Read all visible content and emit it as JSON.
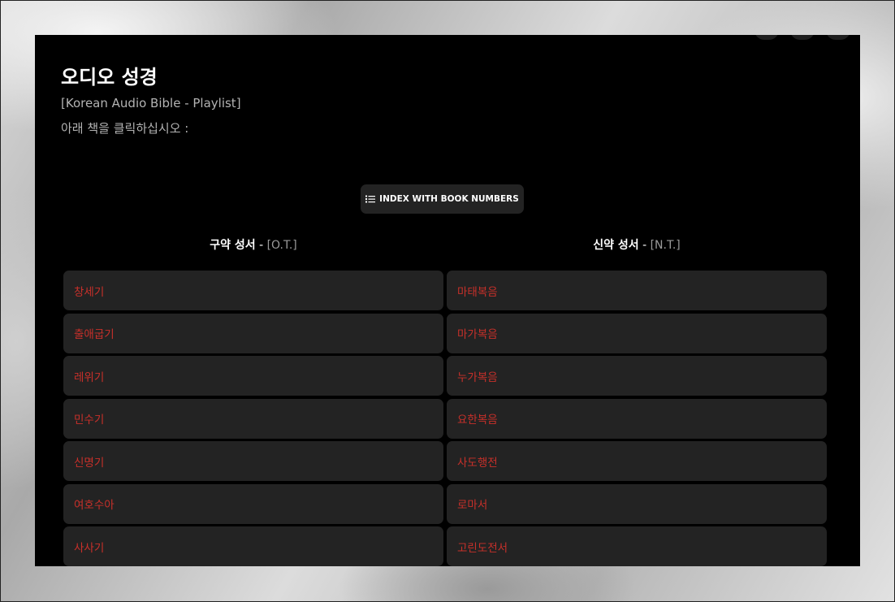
{
  "header": {
    "title": "오디오 성경",
    "subtitle": "[Korean Audio Bible - Playlist]",
    "instruction": "아래 책을 클릭하십시오 :"
  },
  "index_button": {
    "label": "INDEX WITH BOOK NUMBERS",
    "icon": "list-icon"
  },
  "old_testament": {
    "heading": "구약 성서",
    "separator": " - ",
    "abbr": "[O.T.]",
    "books": [
      "창세기",
      "출애굽기",
      "레위기",
      "민수기",
      "신명기",
      "여호수아",
      "사사기"
    ]
  },
  "new_testament": {
    "heading": "신약 성서",
    "separator": " - ",
    "abbr": "[N.T.]",
    "books": [
      "마태복음",
      "마가복음",
      "누가복음",
      "요한복음",
      "사도행전",
      "로마서",
      "고린도전서"
    ]
  },
  "colors": {
    "panel_background": "#000000",
    "item_background": "#232323",
    "book_link": "#c8302a",
    "muted_text": "#b3b3b3"
  }
}
